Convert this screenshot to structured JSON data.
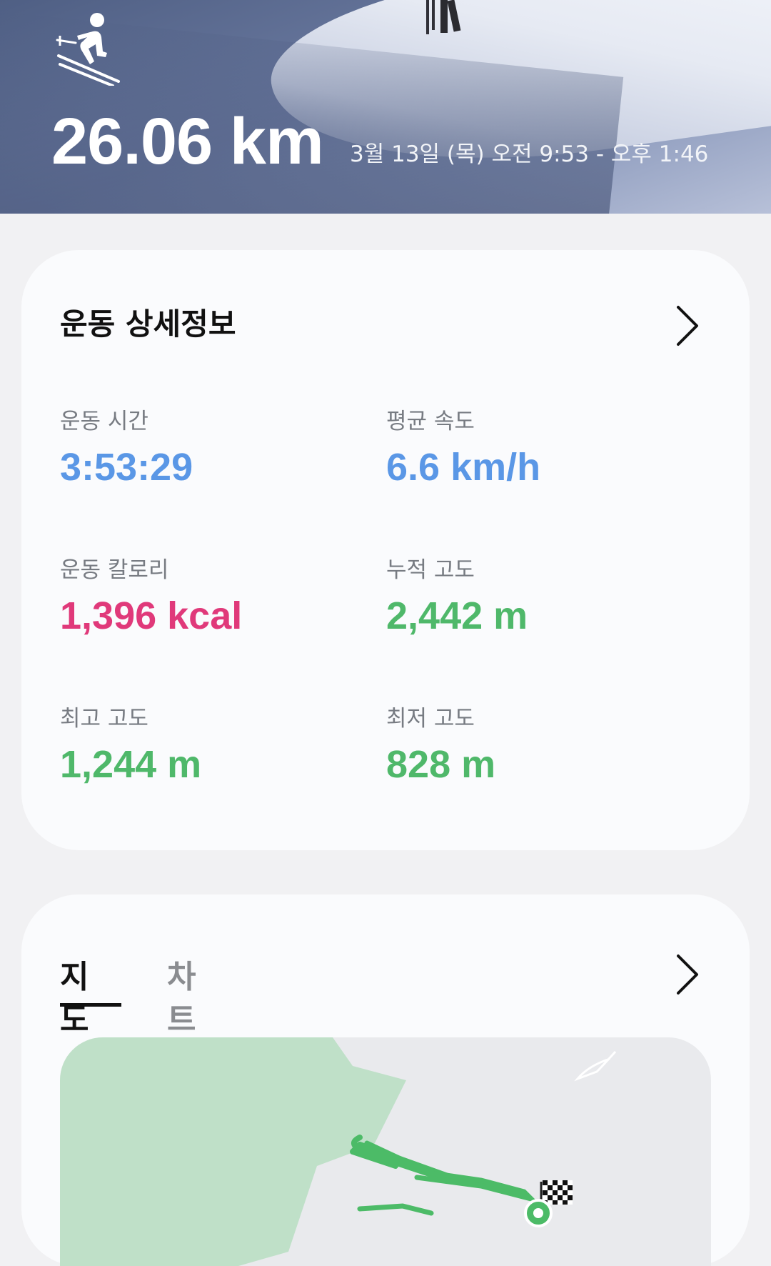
{
  "hero": {
    "activity_icon": "skiing-icon",
    "distance": "26.06 km",
    "datetime": "3월 13일 (목) 오전 9:53 - 오후 1:46"
  },
  "details": {
    "title": "운동 상세정보",
    "chevron_icon": "chevron-right-icon",
    "stats": [
      {
        "label": "운동 시간",
        "value": "3:53:29",
        "color": "#5a97e6"
      },
      {
        "label": "평균 속도",
        "value": "6.6 km/h",
        "color": "#5a97e6"
      },
      {
        "label": "운동 칼로리",
        "value": "1,396 kcal",
        "color": "#e0397a"
      },
      {
        "label": "누적 고도",
        "value": "2,442 m",
        "color": "#4fb86a"
      },
      {
        "label": "최고 고도",
        "value": "1,244 m",
        "color": "#4fb86a"
      },
      {
        "label": "최저 고도",
        "value": "828 m",
        "color": "#4fb86a"
      }
    ]
  },
  "map_card": {
    "tabs": [
      {
        "label": "지도",
        "selected": true
      },
      {
        "label": "차트",
        "selected": false
      }
    ],
    "chevron_icon": "chevron-right-icon",
    "finish_icon": "checkered-flag-icon",
    "start_icon": "start-marker-icon",
    "route_color": "#4cbb67",
    "forest_color": "#bfe0c8"
  }
}
